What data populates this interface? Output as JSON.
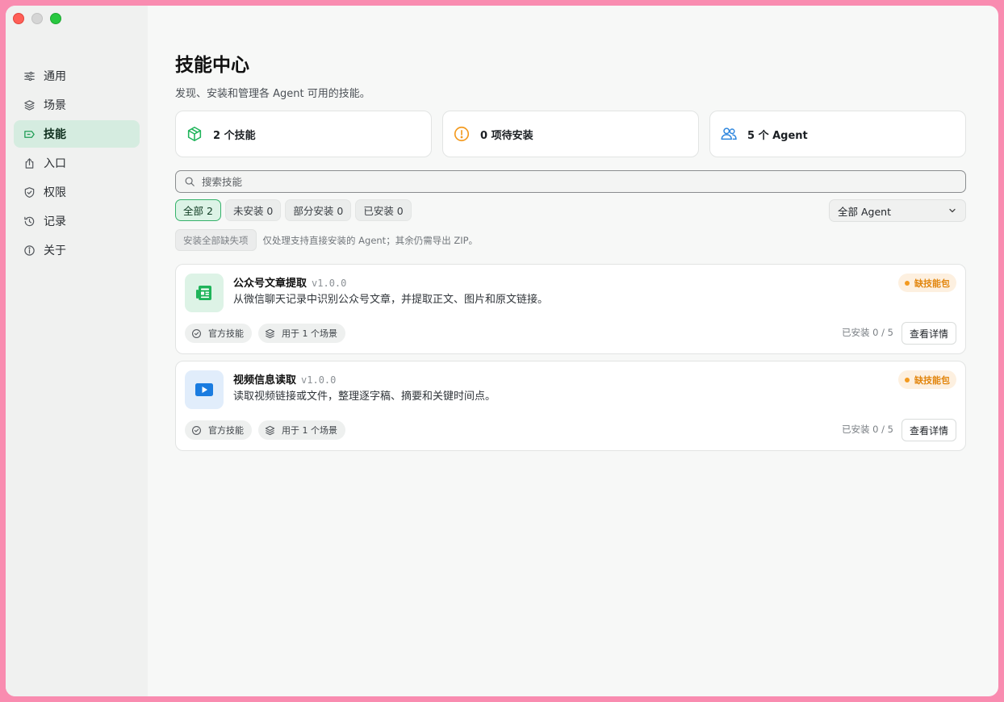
{
  "sidebar": {
    "items": [
      {
        "label": "通用",
        "icon": "sliders-icon",
        "active": false
      },
      {
        "label": "场景",
        "icon": "layers-icon",
        "active": false
      },
      {
        "label": "技能",
        "icon": "skill-icon",
        "active": true
      },
      {
        "label": "入口",
        "icon": "share-icon",
        "active": false
      },
      {
        "label": "权限",
        "icon": "shield-icon",
        "active": false
      },
      {
        "label": "记录",
        "icon": "history-icon",
        "active": false
      },
      {
        "label": "关于",
        "icon": "info-icon",
        "active": false
      }
    ]
  },
  "page": {
    "title": "技能中心",
    "subtitle": "发现、安装和管理各 Agent 可用的技能。"
  },
  "stats": {
    "skills": "2 个技能",
    "pending": "0 项待安装",
    "agents": "5 个 Agent"
  },
  "search": {
    "placeholder": "搜索技能"
  },
  "filters": [
    {
      "label": "全部 2",
      "active": true
    },
    {
      "label": "未安装 0",
      "active": false
    },
    {
      "label": "部分安装 0",
      "active": false
    },
    {
      "label": "已安装 0",
      "active": false
    }
  ],
  "agent_filter": {
    "value": "全部 Agent"
  },
  "bulk": {
    "button": "安装全部缺失项",
    "hint": "仅处理支持直接安装的 Agent；其余仍需导出 ZIP。"
  },
  "skills": [
    {
      "name": "公众号文章提取",
      "version": "v1.0.0",
      "description": "从微信聊天记录中识别公众号文章，并提取正文、图片和原文链接。",
      "badge": "缺技能包",
      "tag_official": "官方技能",
      "tag_scenes": "用于 1 个场景",
      "installed": "已安装 0 / 5",
      "detail_button": "查看详情",
      "icon": "article-icon",
      "icon_bg": "#ddf3e6",
      "icon_color": "#1fb45a"
    },
    {
      "name": "视频信息读取",
      "version": "v1.0.0",
      "description": "读取视频链接或文件，整理逐字稿、摘要和关键时间点。",
      "badge": "缺技能包",
      "tag_official": "官方技能",
      "tag_scenes": "用于 1 个场景",
      "installed": "已安装 0 / 5",
      "detail_button": "查看详情",
      "icon": "play-icon",
      "icon_bg": "#e1edfb",
      "icon_color": "#1a7ce0"
    }
  ],
  "colors": {
    "accent": "#35b26a",
    "warning": "#f39a1f",
    "agent_blue": "#2e86de"
  }
}
